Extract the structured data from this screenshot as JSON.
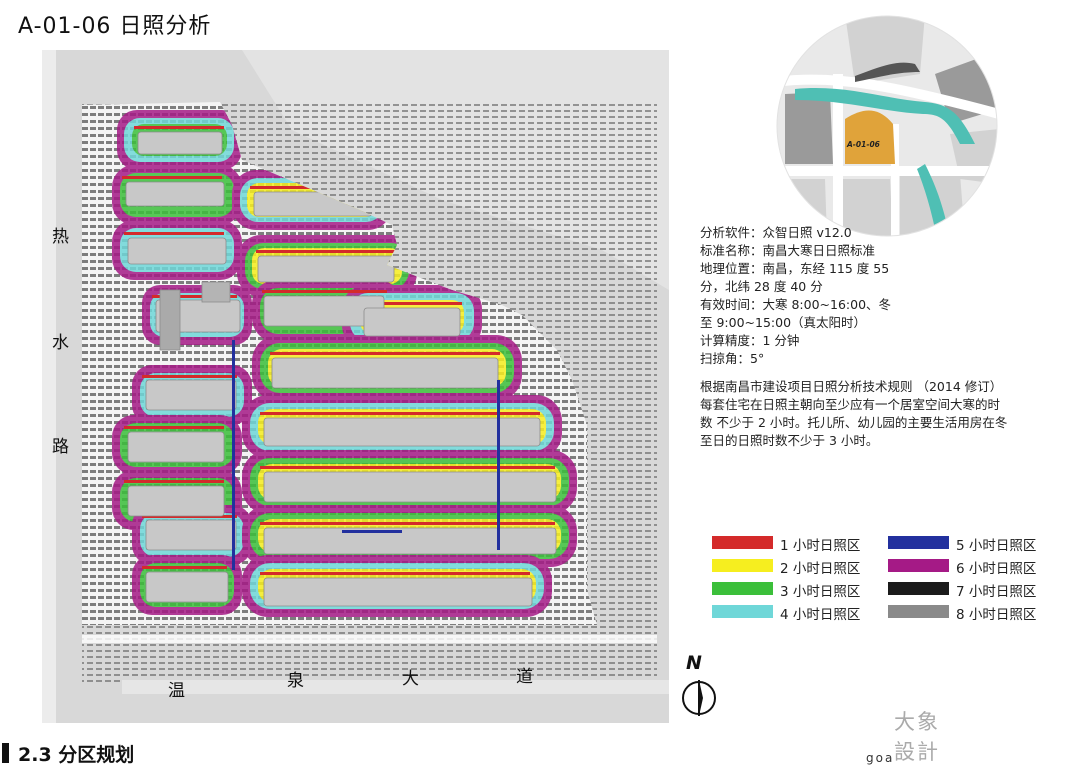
{
  "page": {
    "title": "A-01-06 日照分析"
  },
  "map": {
    "road_west": [
      "热",
      "水",
      "路"
    ],
    "road_south": [
      "温",
      "泉",
      "大",
      "道"
    ]
  },
  "key_map": {
    "plot_label": "A-01-06",
    "plot_color": "#e0a33a",
    "river_color": "#4fbfb4"
  },
  "analysis": {
    "lines": [
      "分析软件：众智日照 v12.0",
      "标准名称：南昌大寒日日照标准",
      "地理位置：南昌，东经 115 度 55",
      "分，北纬 28 度 40 分",
      "有效时间：大寒 8:00~16:00、冬",
      "至 9:00~15:00（真太阳时）",
      "计算精度：1 分钟",
      "扫掠角：5°"
    ],
    "rule_lines": [
      "根据南昌市建设项目日照分析技术规则 （2014 修订）",
      "每套住宅在日照主朝向至少应有一个居室空间大寒的时",
      "数 不少于 2 小时。托儿所、幼儿园的主要生活用房在冬",
      "至日的日照时数不少于 3 小时。"
    ]
  },
  "legend": [
    {
      "label": "1 小时日照区",
      "color": "#d42a2a"
    },
    {
      "label": "2 小时日照区",
      "color": "#f6ee1f"
    },
    {
      "label": "3 小时日照区",
      "color": "#3bbf3a"
    },
    {
      "label": "4 小时日照区",
      "color": "#6fd7d8"
    },
    {
      "label": "5 小时日照区",
      "color": "#22309e"
    },
    {
      "label": "6 小时日照区",
      "color": "#a51a86"
    },
    {
      "label": "7 小时日照区",
      "color": "#1b1b1b"
    },
    {
      "label": "8 小时日照区",
      "color": "#8a8a8a"
    }
  ],
  "north": {
    "label": "N"
  },
  "brand": {
    "cn_line1": "大象",
    "cn_line2": "設計",
    "en": "goa"
  },
  "section": {
    "title": "2.3 分区规划"
  }
}
